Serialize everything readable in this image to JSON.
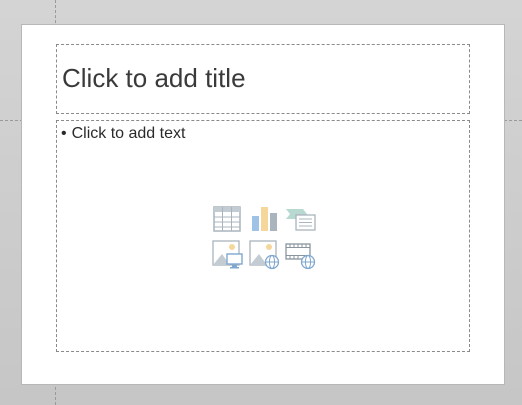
{
  "slide": {
    "title_placeholder": "Click to add title",
    "content_placeholder": "Click to add text",
    "bullet": "•"
  },
  "content_insert_icons": [
    {
      "name": "insert-table-icon"
    },
    {
      "name": "insert-chart-icon"
    },
    {
      "name": "insert-smartart-icon"
    },
    {
      "name": "insert-picture-icon"
    },
    {
      "name": "insert-online-picture-icon"
    },
    {
      "name": "insert-video-icon"
    }
  ],
  "colors": {
    "workspace_bg": "#cfcfcf",
    "slide_bg": "#ffffff",
    "placeholder_border": "#8a8a8a",
    "icon_gray": "#a9b4bd",
    "icon_blue": "#9fc3e6",
    "icon_orange": "#f6d79b",
    "icon_green": "#b7d9cf"
  }
}
